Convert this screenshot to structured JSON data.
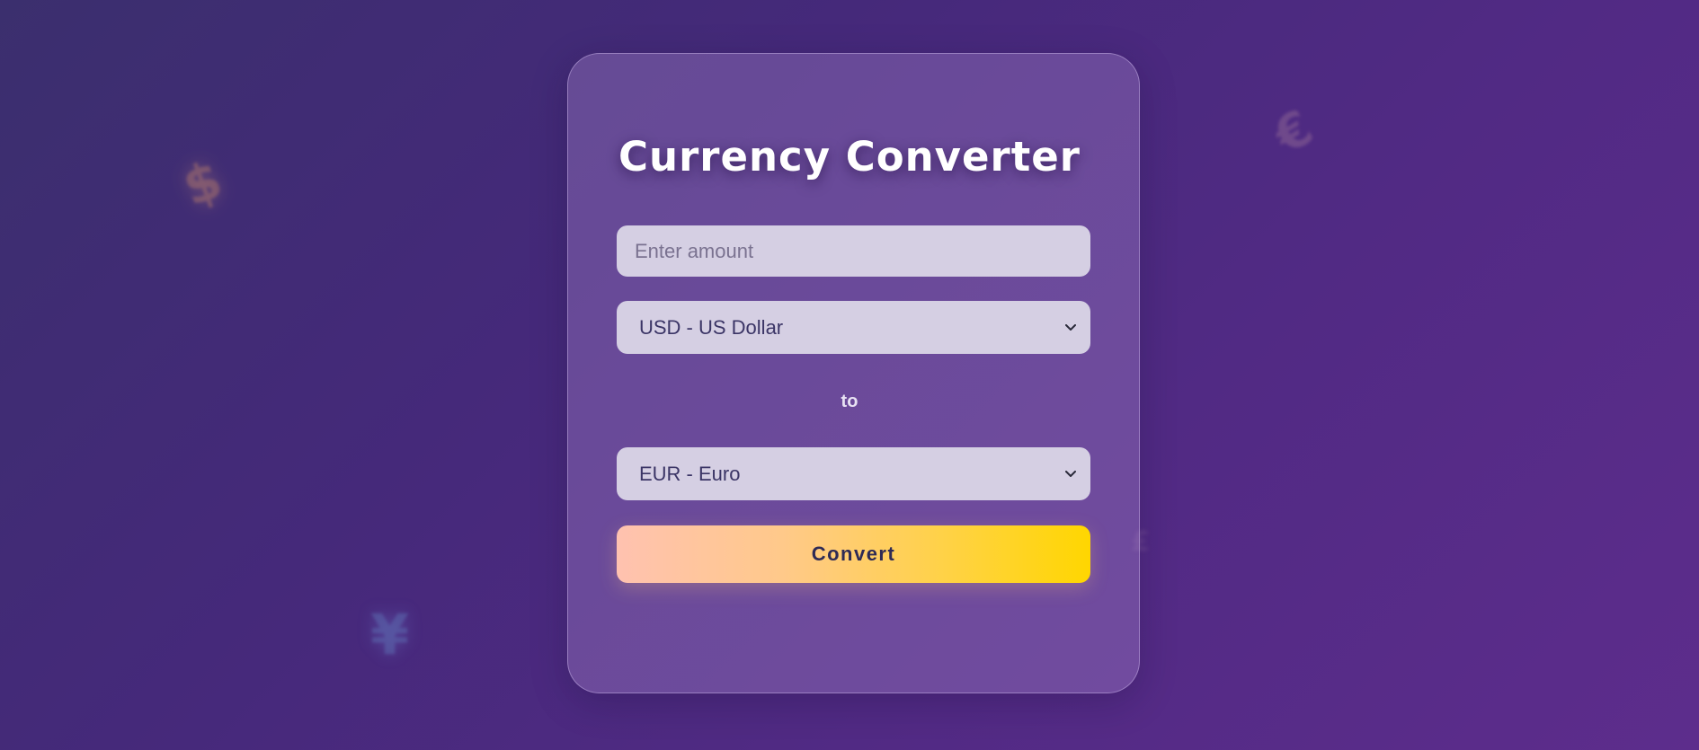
{
  "app": {
    "title": "Currency Converter"
  },
  "decorations": {
    "symbols": [
      "$",
      "€",
      "¥",
      "£"
    ]
  },
  "form": {
    "amount": {
      "value": "",
      "placeholder": "Enter amount"
    },
    "from_currency": {
      "selected": "USD - US Dollar"
    },
    "separator_label": "to",
    "to_currency": {
      "selected": "EUR - Euro"
    },
    "convert_label": "Convert"
  },
  "colors": {
    "background_start": "#3b2f6e",
    "background_end": "#5d2d8c",
    "field_bg": "#d5cfe3",
    "field_text": "#3b3566",
    "button_gradient_start": "#ffc2b0",
    "button_gradient_end": "#ffd600",
    "button_text": "#2e2a55"
  },
  "icons": {
    "select_arrow": "chevron-down-icon"
  }
}
